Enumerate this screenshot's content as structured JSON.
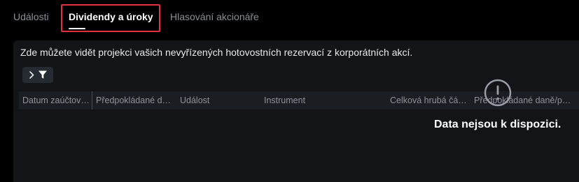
{
  "tabs": [
    {
      "label": "Události"
    },
    {
      "label": "Dividendy a úroky",
      "active": true
    },
    {
      "label": "Hlasování akcionáře"
    }
  ],
  "panel": {
    "description": "Zde můžete vidět projekci vašich nevyřízených hotovostních rezervací z korporátních akcí.",
    "filter_toggle": {
      "icons": [
        "chevron-right-icon",
        "filter-icon"
      ]
    }
  },
  "table": {
    "columns": [
      {
        "label": "Datum zaúčtov…"
      },
      {
        "label": "Předpokládané d…"
      },
      {
        "label": "Událost"
      },
      {
        "label": "Instrument"
      },
      {
        "label": "Celková hrubá čá…"
      },
      {
        "label": "Předpokládané daně/p…"
      }
    ],
    "rows": []
  },
  "empty_state": {
    "icon": "alert-circle-icon",
    "message": "Data nejsou k dispozici."
  },
  "colors": {
    "background": "#000000",
    "panel": "#121418",
    "header_row": "#1a1d22",
    "active_tab_highlight": "#e0313d",
    "muted_text": "#8c9097",
    "primary_text": "#ffffff"
  }
}
